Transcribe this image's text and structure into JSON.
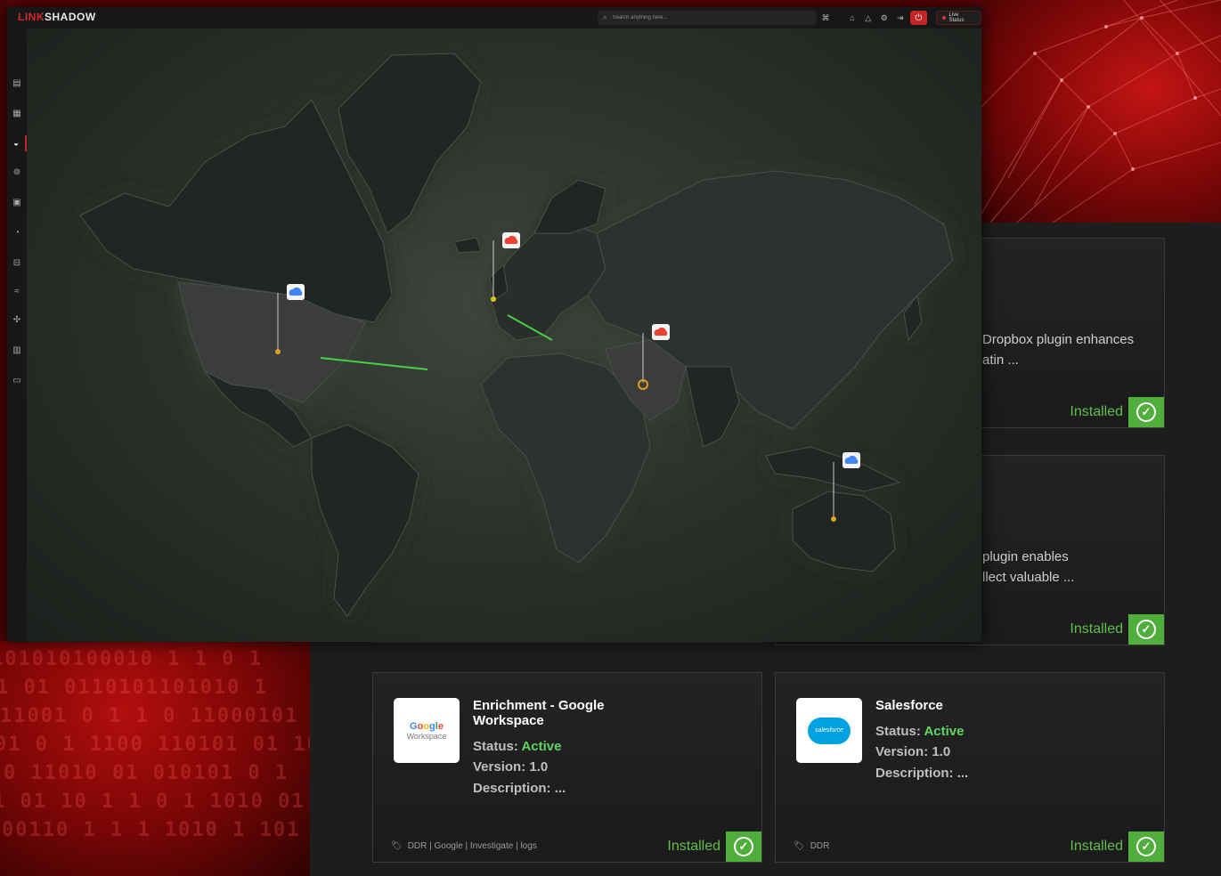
{
  "app": {
    "brand_part1": "LINK",
    "brand_part2": "SHADOW",
    "search_placeholder": "Search anything here...",
    "live_status_label": "Live Status",
    "topbar_icons": [
      "shortcut-icon",
      "home-icon",
      "alert-icon",
      "settings-icon",
      "logout-icon"
    ],
    "sidebar_items": [
      "dashboard-icon",
      "reports-icon",
      "map-icon",
      "devices-icon",
      "assets-icon",
      "monitor-icon",
      "logs-icon",
      "analytics-icon",
      "network-icon",
      "policy-icon",
      "plugins-icon"
    ],
    "active_sidebar_index": 2,
    "accent_color": "#c42424"
  },
  "map": {
    "markers": [
      {
        "name": "cloud-marker-north-america",
        "icon": "google-cloud-icon"
      },
      {
        "name": "cloud-marker-europe",
        "icon": "google-cloud-icon"
      },
      {
        "name": "cloud-marker-middle-east",
        "icon": "google-cloud-icon"
      },
      {
        "name": "cloud-marker-australia",
        "icon": "google-cloud-icon"
      }
    ]
  },
  "plugins": {
    "status_label": "Status:",
    "version_label": "Version:",
    "description_label": "Description:",
    "installed_label": "Installed",
    "cards": [
      {
        "desc_line1": "Dropbox plugin enhances",
        "desc_line2": "atin ...",
        "installed": "Installed"
      },
      {
        "desc_line1": "plugin enables",
        "desc_line2": "llect valuable ...",
        "installed": "Installed"
      },
      {
        "title": "Enrichment - Google Workspace",
        "status": "Active",
        "version": "1.0",
        "description": "...",
        "tags": "DDR | Google | Investigate | logs",
        "logo_line1": "Google",
        "logo_line2": "Workspace",
        "installed": "Installed"
      },
      {
        "title": "Salesforce",
        "status": "Active",
        "version": "1.0",
        "description": "...",
        "tags": "DDR",
        "logo_text": "salesforce",
        "installed": "Installed"
      }
    ]
  },
  "background": {
    "binary_rows": [
      "101010100010 1 1 0 1",
      "1 01 0110101101010 1",
      "11001 0 1  1 0 11000101",
      "01 0 1 1100 110101 01 10",
      "0 11010 01 010101 0 1",
      "1 01 10 1 1 0 1 1010 01",
      "00110 1 1 1 1010 1 101"
    ]
  }
}
